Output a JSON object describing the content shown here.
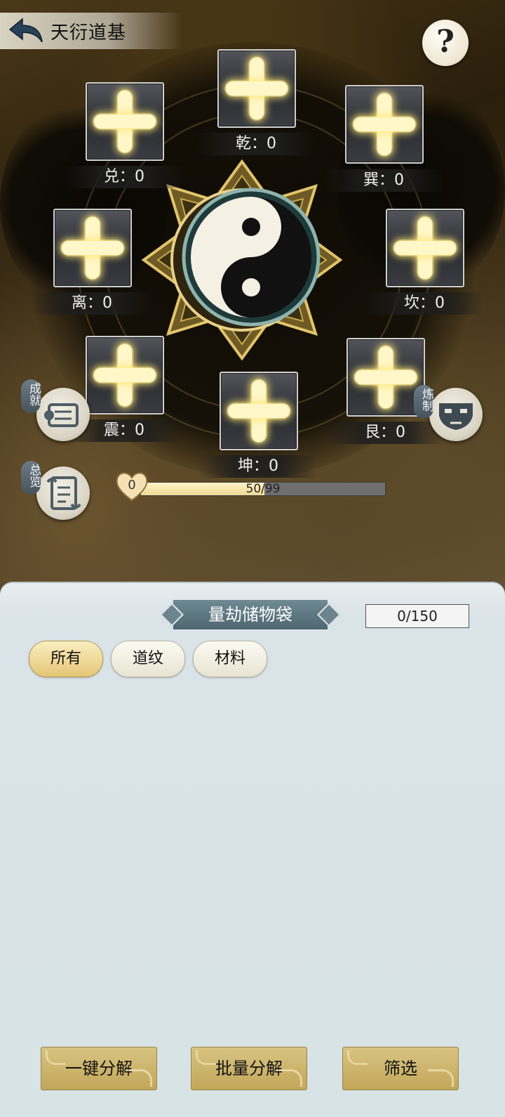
{
  "header": {
    "title": "天衍道基"
  },
  "slots": [
    {
      "label": "乾：0"
    },
    {
      "label": "兑：0"
    },
    {
      "label": "巽：0"
    },
    {
      "label": "离：0"
    },
    {
      "label": "坎：0"
    },
    {
      "label": "震：0"
    },
    {
      "label": "艮：0"
    },
    {
      "label": "坤：0"
    }
  ],
  "side_buttons": {
    "achievement": "成就",
    "overview": "总览",
    "refine": "炼制"
  },
  "progress": {
    "heart_value": "0",
    "text": "50/99",
    "fraction": 0.505
  },
  "bag": {
    "title": "量劫储物袋",
    "capacity": "0/150",
    "tabs": [
      {
        "label": "所有",
        "active": true
      },
      {
        "label": "道纹",
        "active": false
      },
      {
        "label": "材料",
        "active": false
      }
    ],
    "buttons": {
      "decompose_all": "一键分解",
      "batch_decompose": "批量分解",
      "filter": "筛选"
    }
  },
  "icons": [
    "back-arrow-icon",
    "help-question-icon",
    "scroll-icon",
    "scroll-open-icon",
    "mask-icon",
    "heart-icon",
    "taiji-icon"
  ]
}
